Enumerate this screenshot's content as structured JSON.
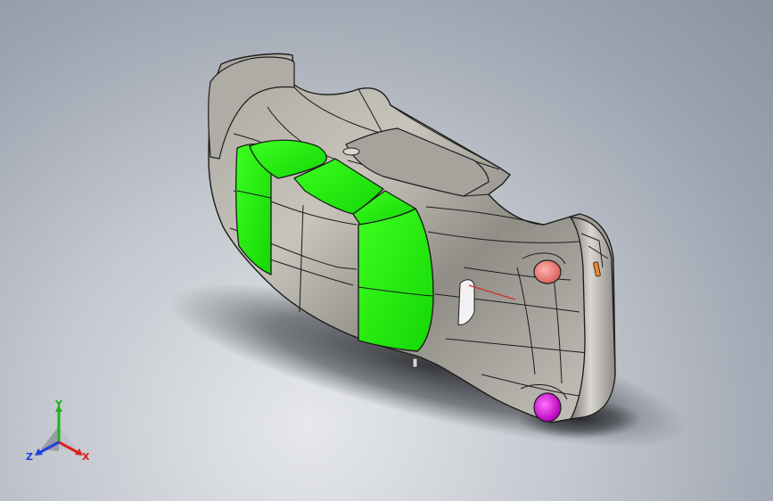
{
  "viewport": {
    "colors": {
      "surface": "#b9b7ae",
      "glass": "#22ee0c",
      "left_lamp": "#ee7f78",
      "right_lamp": "#e01ee0",
      "indicator": "#f08a1e"
    }
  },
  "triad": {
    "x_label": "X",
    "y_label": "Y",
    "z_label": "Z",
    "x_color": "#e02020",
    "y_color": "#20b020",
    "z_color": "#2040e0"
  }
}
